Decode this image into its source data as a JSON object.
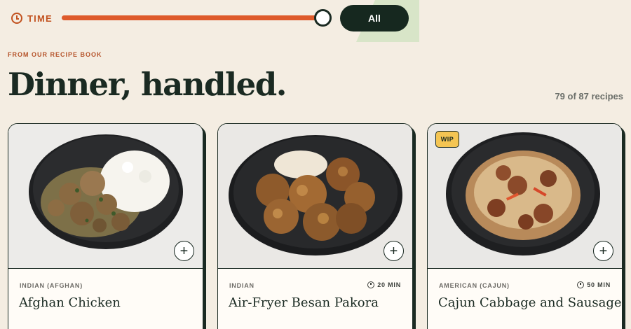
{
  "filters": {
    "time_label": "TIME",
    "time_slider_value_percent": 100,
    "all_button_label": "All"
  },
  "header": {
    "eyebrow": "FROM OUR RECIPE BOOK",
    "title": "Dinner, handled.",
    "count": "79 of 87 recipes"
  },
  "recipes": [
    {
      "cuisine": "INDIAN (AFGHAN)",
      "time": "",
      "title": "Afghan Chicken",
      "badge": "",
      "add_label": "+"
    },
    {
      "cuisine": "INDIAN",
      "time": "20 MIN",
      "title": "Air-Fryer Besan Pakora",
      "badge": "",
      "add_label": "+"
    },
    {
      "cuisine": "AMERICAN (CAJUN)",
      "time": "50 MIN",
      "title": "Cajun Cabbage and Sausage",
      "badge": "WIP",
      "add_label": "+"
    }
  ],
  "colors": {
    "background": "#f4ede2",
    "accent": "#de5a2b",
    "dark": "#16281f",
    "badge": "#f4c553"
  }
}
